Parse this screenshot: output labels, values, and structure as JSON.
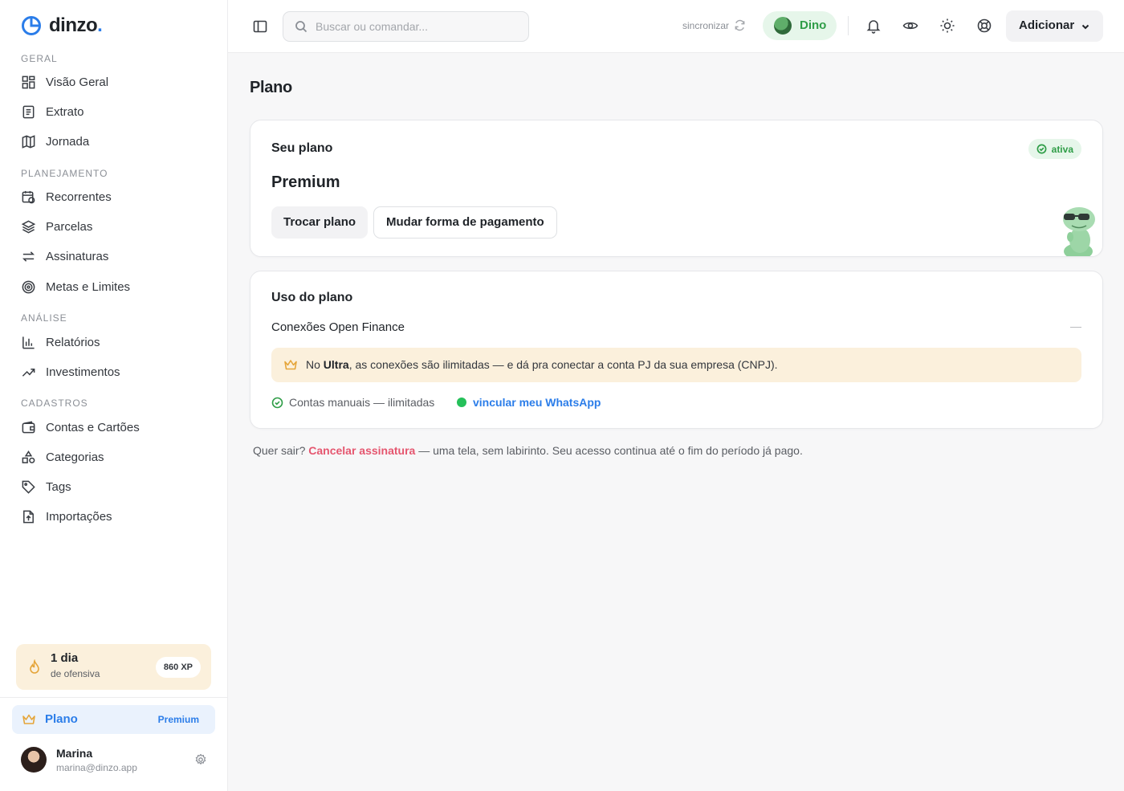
{
  "brand": {
    "name": "dinzo",
    "dot": "."
  },
  "sidebar": {
    "sections": [
      {
        "title": "GERAL"
      },
      {
        "title": "PLANEJAMENTO"
      },
      {
        "title": "ANÁLISE"
      },
      {
        "title": "CADASTROS"
      }
    ],
    "items": [
      {
        "label": "Visão Geral",
        "icon": "grid-icon"
      },
      {
        "label": "Extrato",
        "icon": "document-icon"
      },
      {
        "label": "Jornada",
        "icon": "map-icon"
      },
      {
        "label": "Recorrentes",
        "icon": "calendar-repeat-icon"
      },
      {
        "label": "Parcelas",
        "icon": "layers-icon"
      },
      {
        "label": "Assinaturas",
        "icon": "arrows-swap-icon"
      },
      {
        "label": "Metas e Limites",
        "icon": "target-icon"
      },
      {
        "label": "Relatórios",
        "icon": "bar-chart-icon"
      },
      {
        "label": "Investimentos",
        "icon": "trending-up-icon"
      },
      {
        "label": "Contas e Cartões",
        "icon": "wallet-icon"
      },
      {
        "label": "Categorias",
        "icon": "shapes-icon"
      },
      {
        "label": "Tags",
        "icon": "tag-icon"
      },
      {
        "label": "Importações",
        "icon": "file-upload-icon"
      }
    ],
    "streak": {
      "days": "1 dia",
      "label": "de ofensiva",
      "xp": "860 XP"
    },
    "plan": {
      "label": "Plano",
      "tier": "Premium"
    },
    "user": {
      "name": "Marina",
      "email": "marina@dinzo.app"
    }
  },
  "topbar": {
    "search_placeholder": "Buscar ou comandar...",
    "sync_label": "sincronizar",
    "dino_label": "Dino",
    "add_label": "Adicionar"
  },
  "main": {
    "title": "Plano",
    "plan_card": {
      "title": "Seu plano",
      "status": "ativa",
      "plan_name": "Premium",
      "change_plan": "Trocar plano",
      "change_payment": "Mudar forma de pagamento"
    },
    "usage_card": {
      "title": "Uso do plano",
      "open_finance": "Conexões Open Finance",
      "open_finance_value": "—",
      "notice_prefix": "No ",
      "notice_bold": "Ultra",
      "notice_suffix": ", as conexões são ilimitadas — e dá pra conectar a conta PJ da sua empresa (CNPJ).",
      "manual_accounts": "Contas manuais — ilimitadas",
      "whatsapp_link": "vincular meu WhatsApp"
    },
    "footer": {
      "prefix": "Quer sair? ",
      "cancel": "Cancelar assinatura",
      "suffix": " — uma tela, sem labirinto. Seu acesso continua até o fim do período já pago."
    }
  },
  "colors": {
    "accent": "#2b7de9",
    "success": "#2f9d47",
    "danger": "#e5566f",
    "warning_bg": "#fbf0dc"
  }
}
